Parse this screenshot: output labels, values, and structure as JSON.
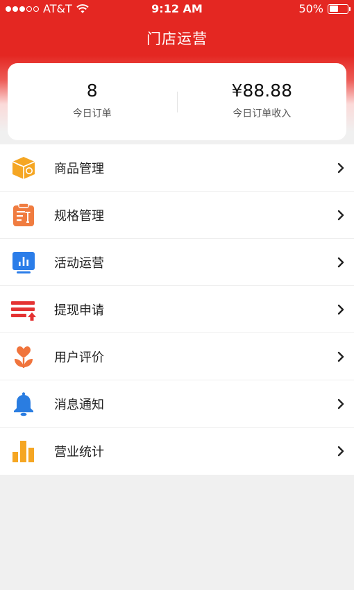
{
  "status_bar": {
    "carrier": "AT&T",
    "time": "9:12 AM",
    "battery_percent": "50%",
    "battery_level": 0.5,
    "signal_bars_filled": 3,
    "signal_bars_total": 5
  },
  "header": {
    "title": "门店运营"
  },
  "summary": {
    "orders_today_value": "8",
    "orders_today_label": "今日订单",
    "revenue_today_value": "¥88.88",
    "revenue_today_label": "今日订单收入"
  },
  "menu": {
    "items": [
      {
        "label": "商品管理",
        "icon": "package-box-icon"
      },
      {
        "label": "规格管理",
        "icon": "spec-clipboard-icon"
      },
      {
        "label": "活动运营",
        "icon": "activity-chart-icon"
      },
      {
        "label": "提现申请",
        "icon": "withdraw-icon"
      },
      {
        "label": "用户评价",
        "icon": "heart-flower-icon"
      },
      {
        "label": "消息通知",
        "icon": "bell-icon"
      },
      {
        "label": "营业统计",
        "icon": "bar-chart-icon"
      }
    ]
  },
  "colors": {
    "brand_red": "#e42722",
    "box_orange": "#f5a623",
    "clipboard_orange": "#f07c40",
    "chart_blue": "#2b7de9",
    "withdraw_red": "#e43232",
    "flower_orange": "#f0743c",
    "bell_blue": "#2a7de1",
    "stats_orange": "#f5a623"
  }
}
